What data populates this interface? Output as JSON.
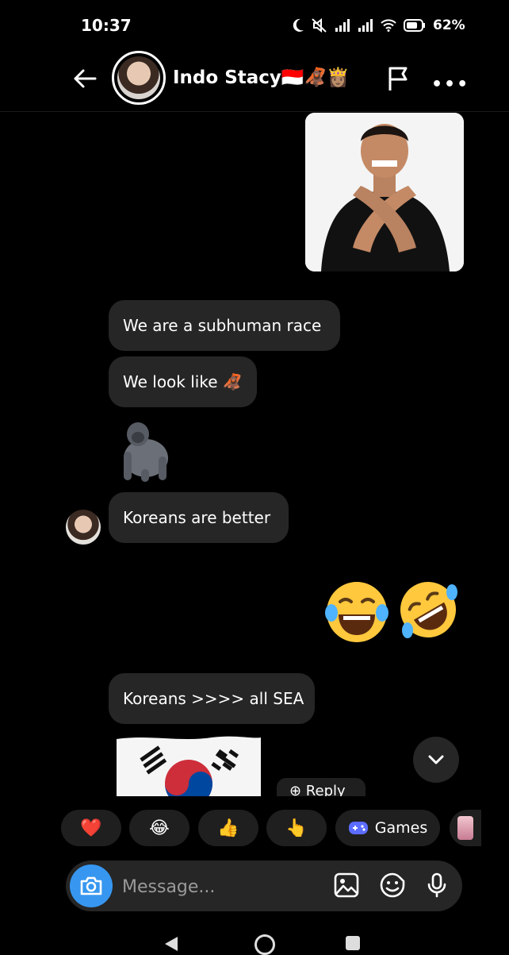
{
  "status_bar": {
    "time": "10:37",
    "battery": "62%"
  },
  "header": {
    "contact_name": "Indo Stacy🇮🇩🦧👸🏽"
  },
  "messages": [
    {
      "text": "We are a subhuman race"
    },
    {
      "text": "We look like 🦧"
    },
    {
      "text": "Koreans are better"
    },
    {
      "text": "Koreans >>>> all SEA"
    }
  ],
  "emoji": {
    "gorilla": "🦍",
    "laugh_tears": "😂",
    "rofl": "🤣"
  },
  "reply_chip": "⊕ Reply",
  "quick_reactions": {
    "heart": "❤️",
    "joy": "😂",
    "thumbs_up": "👍",
    "point": "👆",
    "games_label": "Games"
  },
  "composer": {
    "placeholder": "Message..."
  },
  "colors": {
    "background": "#000000",
    "bubble": "#262626",
    "accent_blue": "#3797f0",
    "games_icon": "#5b6cff"
  },
  "icons": [
    "back-arrow-icon",
    "flag-icon",
    "more-icon",
    "camera-icon",
    "gallery-icon",
    "sticker-icon",
    "mic-icon",
    "chevron-down-icon",
    "gamepad-icon"
  ]
}
